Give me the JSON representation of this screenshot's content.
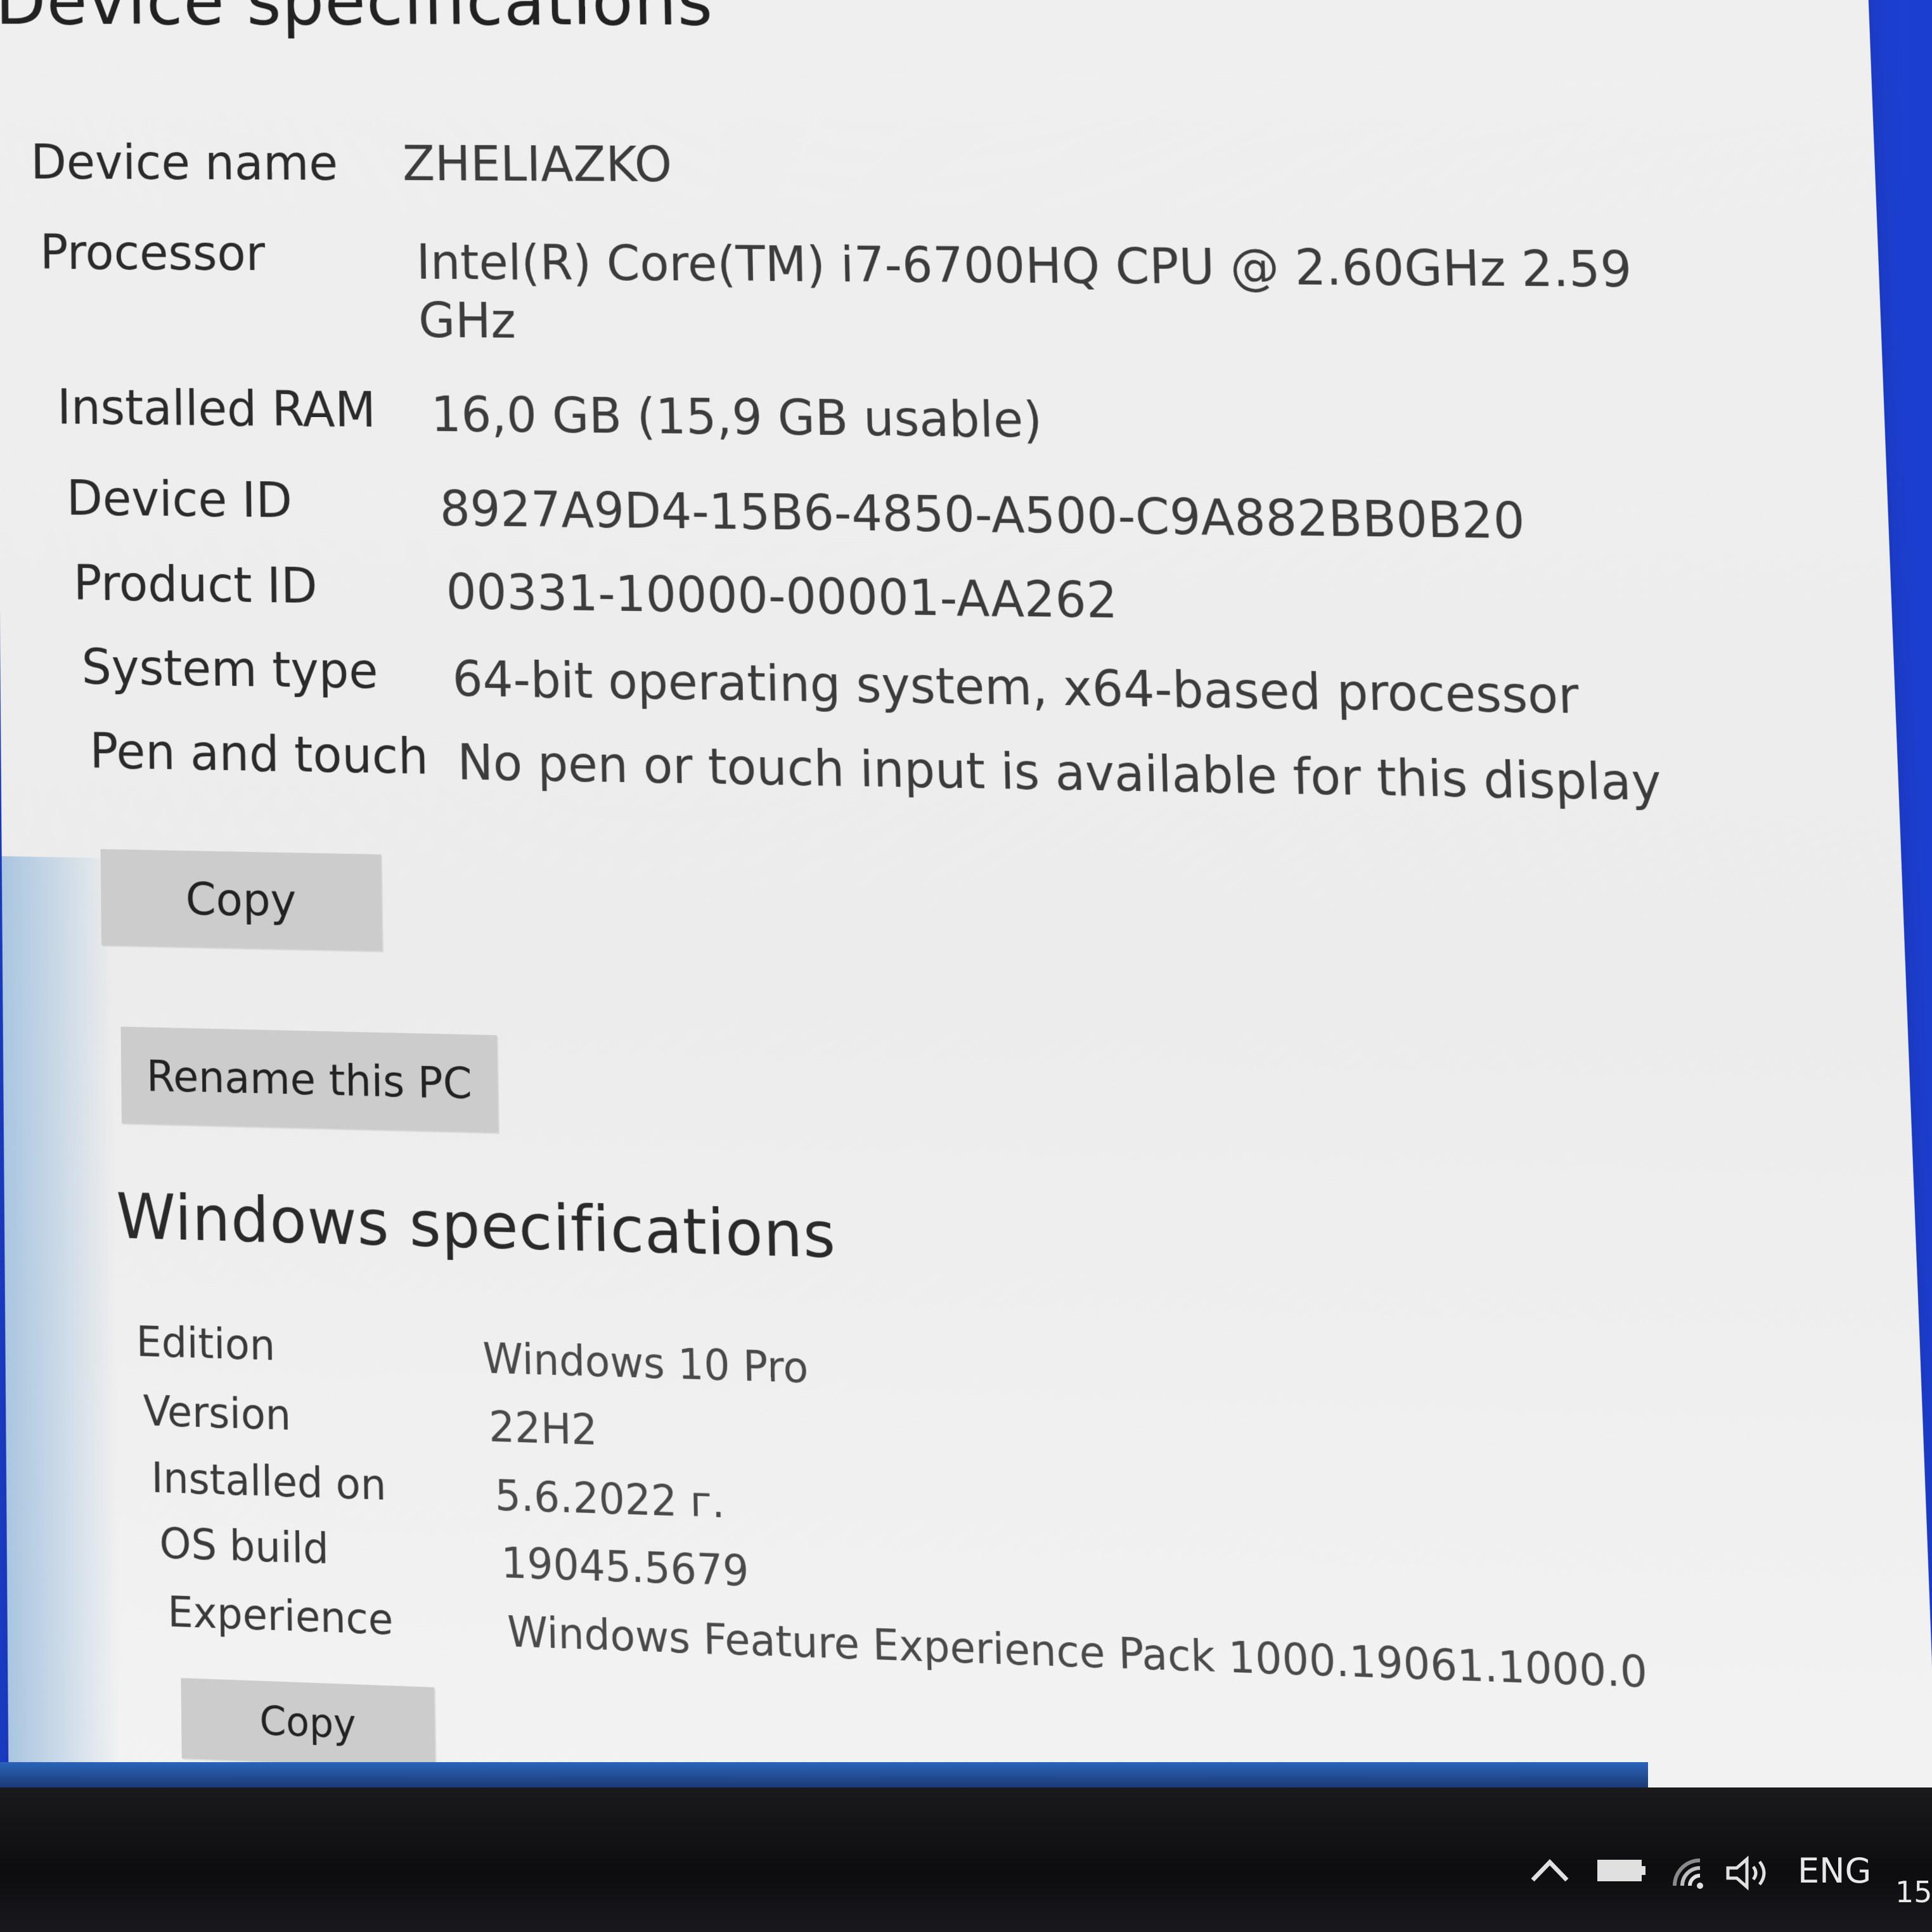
{
  "device_specifications": {
    "heading": "Device specifications",
    "rows": [
      {
        "label": "Device name",
        "value": "ZHELIAZKO"
      },
      {
        "label": "Processor",
        "value": "Intel(R) Core(TM) i7-6700HQ CPU @ 2.60GHz   2.59",
        "value_line2": "GHz"
      },
      {
        "label": "Installed RAM",
        "value": "16,0 GB (15,9 GB usable)"
      },
      {
        "label": "Device ID",
        "value": "8927A9D4-15B6-4850-A500-C9A882BB0B20"
      },
      {
        "label": "Product ID",
        "value": "00331-10000-00001-AA262"
      },
      {
        "label": "System type",
        "value": "64-bit operating system, x64-based processor"
      },
      {
        "label": "Pen and touch",
        "value": "No pen or touch input is available for this display"
      }
    ],
    "copy_button": "Copy",
    "rename_button": "Rename this PC"
  },
  "windows_specifications": {
    "heading": "Windows specifications",
    "rows": [
      {
        "label": "Edition",
        "value": "Windows 10 Pro"
      },
      {
        "label": "Version",
        "value": "22H2"
      },
      {
        "label": "Installed on",
        "value": "5.6.2022 г."
      },
      {
        "label": "OS build",
        "value": "19045.5679"
      },
      {
        "label": "Experience",
        "value": "Windows Feature Experience Pack 1000.19061.1000.0"
      }
    ],
    "copy_button": "Copy"
  },
  "taskbar": {
    "tray_icons": [
      "chevron-up-icon",
      "battery-icon",
      "wifi-icon",
      "speaker-icon"
    ],
    "language": "ENG",
    "clock_partial": "15"
  }
}
